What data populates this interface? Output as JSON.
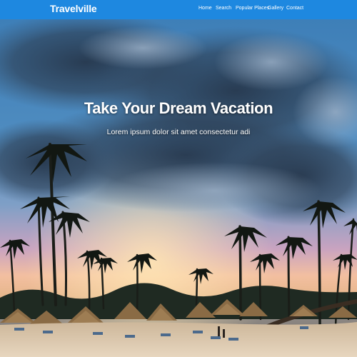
{
  "navbar": {
    "brand": "Travelville",
    "background_color": "#1e88e0",
    "links": [
      {
        "label": "Home"
      },
      {
        "label": "Search"
      },
      {
        "label": "Popular Places"
      },
      {
        "label": "Gallery"
      },
      {
        "label": "Contact"
      }
    ]
  },
  "hero": {
    "title": "Take Your Dream Vacation",
    "subtitle": "Lorem ipsum dolor sit amet consectetur adi",
    "background_image": "tropical beach with palm trees and umbrellas at sunset"
  }
}
